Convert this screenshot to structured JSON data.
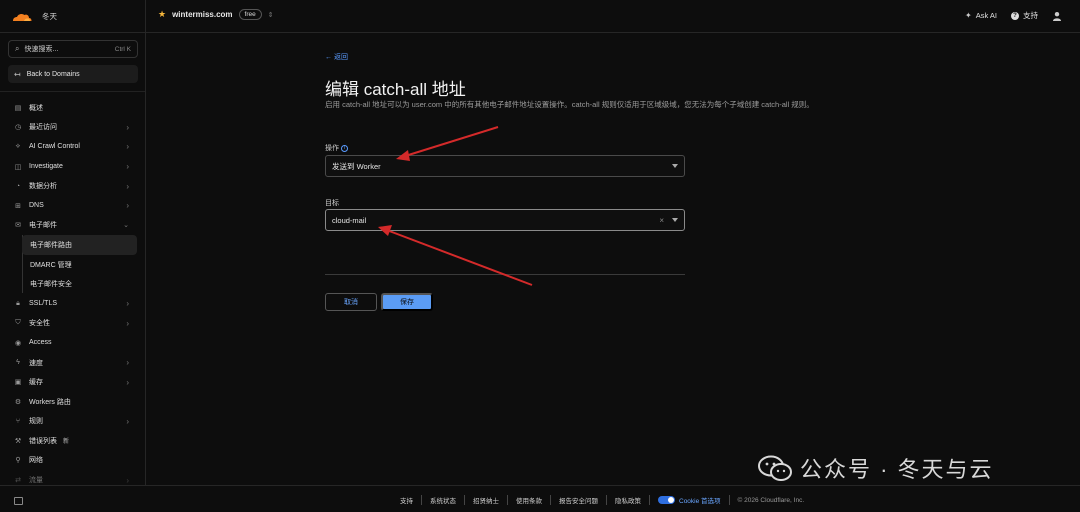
{
  "topbar": {
    "account_name": "冬天",
    "domain": "wintermiss.com",
    "plan": "free",
    "ask_ai": "Ask AI",
    "support": "支持"
  },
  "sidebar": {
    "search_placeholder": "快速搜索...",
    "search_shortcut": "Ctrl K",
    "back_to_domains": "Back to Domains",
    "items": [
      {
        "label": "概述",
        "icon": "overview-icon",
        "chevron": false
      },
      {
        "label": "最近访问",
        "icon": "clock-icon",
        "chevron": true
      },
      {
        "label": "AI Crawl Control",
        "icon": "ai-icon",
        "chevron": true
      },
      {
        "label": "Investigate",
        "icon": "investigate-icon",
        "chevron": true
      },
      {
        "label": "数据分析",
        "icon": "analytics-icon",
        "chevron": true
      },
      {
        "label": "DNS",
        "icon": "dns-icon",
        "chevron": true
      },
      {
        "label": "电子邮件",
        "icon": "mail-icon",
        "chevron": true,
        "expanded": true
      },
      {
        "label": "电子邮件路由",
        "sub": true,
        "active": true
      },
      {
        "label": "DMARC 管理",
        "sub": true
      },
      {
        "label": "电子邮件安全",
        "sub": true
      },
      {
        "label": "SSL/TLS",
        "icon": "lock-icon",
        "chevron": true
      },
      {
        "label": "安全性",
        "icon": "shield-icon",
        "chevron": true
      },
      {
        "label": "Access",
        "icon": "access-icon",
        "chevron": false
      },
      {
        "label": "速度",
        "icon": "bolt-icon",
        "chevron": true
      },
      {
        "label": "缓存",
        "icon": "cache-icon",
        "chevron": true
      },
      {
        "label": "Workers 路由",
        "icon": "workers-icon",
        "chevron": false
      },
      {
        "label": "规则",
        "icon": "rules-icon",
        "chevron": true
      },
      {
        "label": "错误列表",
        "icon": "wrench-icon",
        "chevron": false,
        "tag": "新"
      },
      {
        "label": "网络",
        "icon": "network-icon",
        "chevron": false
      },
      {
        "label": "流量",
        "icon": "traffic-icon",
        "chevron": true
      }
    ]
  },
  "main": {
    "back_label": "← 返回",
    "title": "编辑 catch-all 地址",
    "description": "启用 catch-all 地址可以为 user.com 中的所有其他电子邮件地址设置操作。catch-all 规则仅适用于区域级域，您无法为每个子域创建 catch-all 规则。",
    "action_label": "操作",
    "action_value": "发送到 Worker",
    "target_label": "目标",
    "target_value": "cloud-mail",
    "cancel_label": "取消",
    "save_label": "保存"
  },
  "footer": {
    "links": [
      "支持",
      "系统状态",
      "招贤纳士",
      "使用条款",
      "报告安全问题",
      "隐私政策"
    ],
    "cookie_label": "Cookie 首选项",
    "copyright": "© 2026 Cloudflare, Inc."
  },
  "watermark": {
    "text": "公众号 · 冬天与云"
  },
  "colors": {
    "accent": "#5b9cf5",
    "link": "#5a9bff",
    "annotation": "#d42a2a",
    "brand_orange": "#f38020"
  }
}
